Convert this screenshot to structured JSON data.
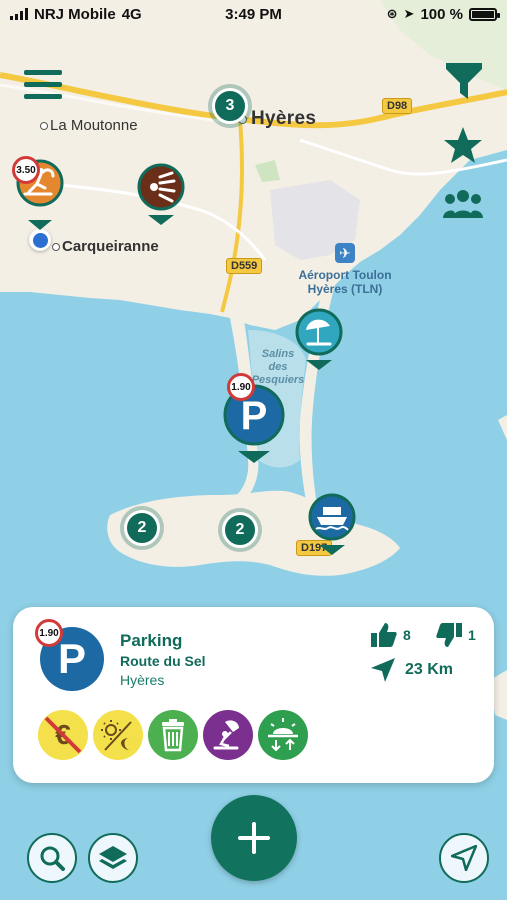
{
  "status": {
    "carrier": "NRJ Mobile",
    "network": "4G",
    "time": "3:49 PM",
    "battery_text": "100 %",
    "battery_level": 1.0
  },
  "map": {
    "labels": {
      "la_moutonne": "La Moutonne",
      "hyeres": "Hyères",
      "carqueiranne": "Carqueiranne",
      "airport_line1": "Aéroport Toulon",
      "airport_line2": "Hyères (TLN)",
      "salins_line1": "Salins",
      "salins_line2": "des",
      "salins_line3": "Pesquiers"
    },
    "roads": {
      "d98": "D98",
      "d559": "D559",
      "d197": "D197"
    },
    "clusters": {
      "top": "3",
      "left": "2",
      "right": "2"
    },
    "prices": {
      "kitesurf": "3.50",
      "parking": "1.90"
    }
  },
  "card": {
    "price": "1.90",
    "title": "Parking",
    "subtitle": "Route du Sel",
    "city": "Hyères",
    "likes": "8",
    "dislikes": "1",
    "distance": "23 Km"
  },
  "colors": {
    "primary": "#116b5a",
    "parking_blue": "#1d69a4",
    "kite_orange": "#e4872f",
    "beach_teal": "#30a7bf",
    "ferry_blue": "#1d69a4",
    "feat_yellow": "#f4e04b",
    "feat_green": "#4caf50",
    "feat_purple": "#7b2f8e",
    "feat_teal_green": "#2e9e4f"
  },
  "icons": {
    "menu": "menu-icon",
    "filter": "filter-icon",
    "favorites": "star-icon",
    "community": "users-icon",
    "search": "search-icon",
    "layers": "layers-icon",
    "add": "plus-icon",
    "locate": "navigation-arrow-icon"
  }
}
